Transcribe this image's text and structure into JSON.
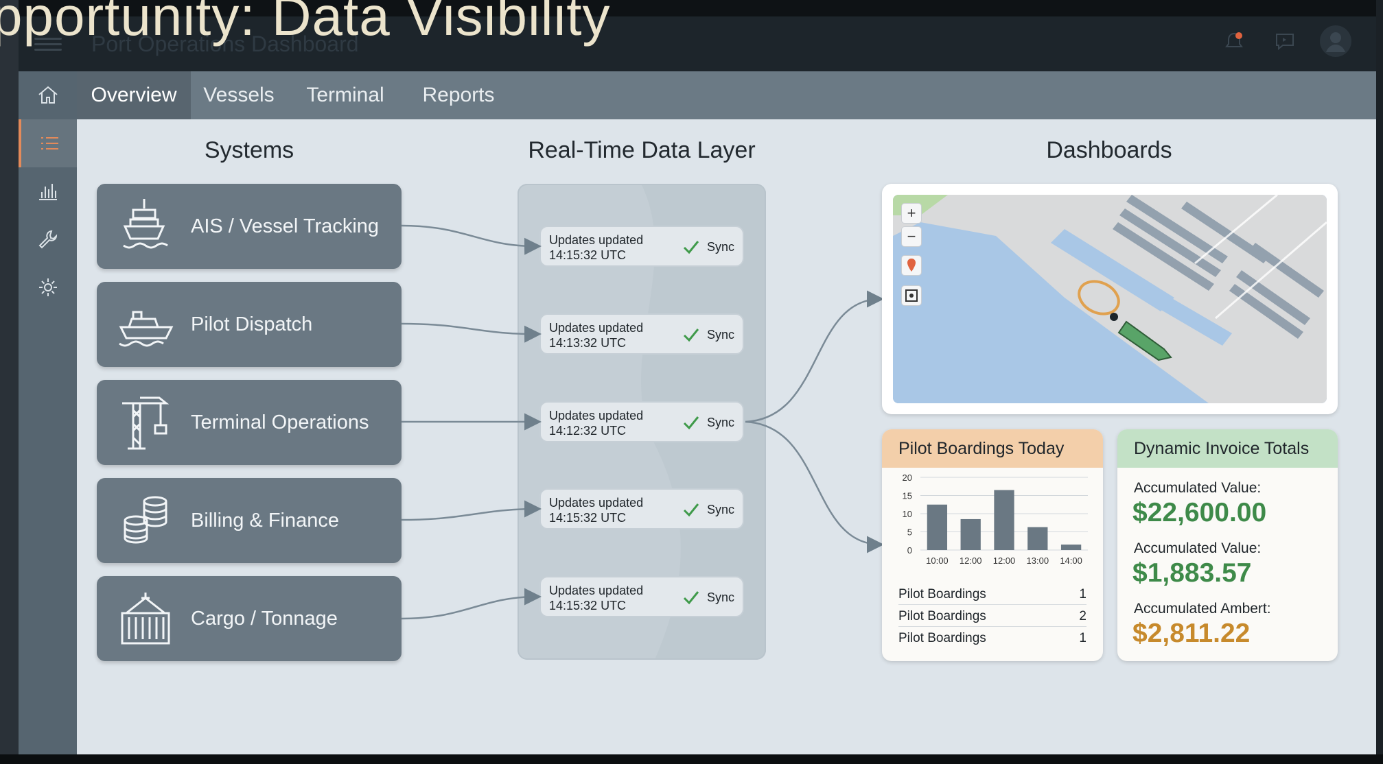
{
  "overlay_title": "pportunity: Data Visibility",
  "app": {
    "title": "Port Operations Dashboard"
  },
  "topbar": {
    "icons": [
      "bell-icon",
      "chat-icon",
      "avatar-icon"
    ],
    "notification_dot_color": "#e0633f"
  },
  "sidebar": {
    "items": [
      "home-icon",
      "list-icon",
      "bar-chart-icon",
      "wrench-icon",
      "gear-icon"
    ],
    "active": "list-icon",
    "accent_color": "#e48a5a"
  },
  "tabs": [
    {
      "label": "Overview",
      "active": true
    },
    {
      "label": "Vessels",
      "active": false
    },
    {
      "label": "Terminal",
      "active": false
    },
    {
      "label": "Reports",
      "active": false
    }
  ],
  "columns": {
    "systems": "Systems",
    "data_layer": "Real-Time Data Layer",
    "dashboards": "Dashboards"
  },
  "systems": [
    {
      "label": "AIS / Vessel Tracking",
      "icon": "ship-icon"
    },
    {
      "label": "Pilot Dispatch",
      "icon": "boat-icon"
    },
    {
      "label": "Terminal Operations",
      "icon": "crane-icon"
    },
    {
      "label": "Billing & Finance",
      "icon": "coins-icon"
    },
    {
      "label": "Cargo / Tonnage",
      "icon": "container-icon"
    }
  ],
  "sync_items": [
    {
      "line1": "Updates updated",
      "line2": "14:15:32 UTC",
      "status": "Sync"
    },
    {
      "line1": "Updates updated",
      "line2": "14:13:32 UTC",
      "status": "Sync"
    },
    {
      "line1": "Updates updated",
      "line2": "14:12:32 UTC",
      "status": "Sync"
    },
    {
      "line1": "Updates updated",
      "line2": "14:15:32 UTC",
      "status": "Sync"
    },
    {
      "line1": "Updates updated",
      "line2": "14:15:32 UTC",
      "status": "Sync"
    }
  ],
  "sync_check_color": "#3f9a4a",
  "map": {
    "controls": [
      "+",
      "−"
    ],
    "icons": [
      "location-pin-icon",
      "recenter-icon"
    ]
  },
  "pilot_panel": {
    "title": "Pilot Boardings Today",
    "header_color": "#f3cfaa",
    "chart_data": {
      "type": "bar",
      "categories": [
        "10:00",
        "12:00",
        "12:00",
        "13:00",
        "14:00"
      ],
      "values": [
        12.5,
        8.5,
        16.5,
        6.3,
        1.5
      ],
      "yticks": [
        0,
        5,
        10,
        15,
        20
      ],
      "ylim": [
        0,
        20
      ],
      "bar_color": "#6a7883",
      "grid": true
    },
    "rows": [
      {
        "label": "Pilot Boardings",
        "value": "1"
      },
      {
        "label": "Pilot Boardings",
        "value": "2"
      },
      {
        "label": "Pilot Boardings",
        "value": "1"
      }
    ]
  },
  "invoice_panel": {
    "title": "Dynamic Invoice Totals",
    "header_color": "#c3e1c6",
    "items": [
      {
        "label": "Accumulated Value:",
        "value": "$22,600.00",
        "color": "#3e8a49"
      },
      {
        "label": "Accumulated Value:",
        "value": "$1,883.57",
        "color": "#3e8a49"
      },
      {
        "label": "Accumulated Ambert:",
        "value": "$2,811.22",
        "color": "#c78a2c"
      }
    ]
  }
}
